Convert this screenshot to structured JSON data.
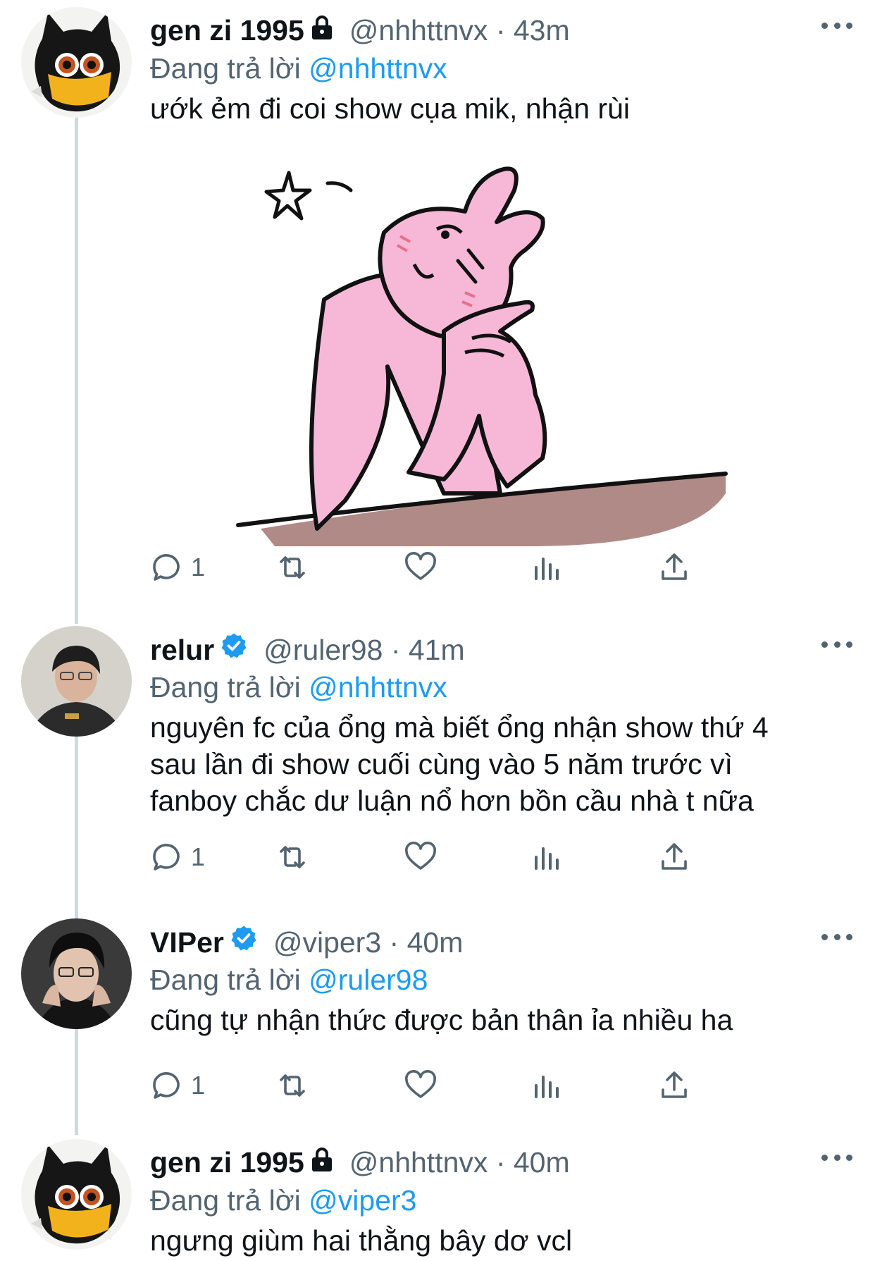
{
  "colors": {
    "accent": "#1d9bf0",
    "text_primary": "#0f1419",
    "text_secondary": "#536471",
    "thread_line": "#cfd9de",
    "sticker_pink": "#f7b8d8",
    "table_brown": "#b08a87"
  },
  "tweets": [
    {
      "display_name": "gen zi 1995",
      "badge": "lock-icon",
      "handle": "@nhhttnvx",
      "time": "43m",
      "replying_prefix": "Đang trả lời",
      "replying_to": "@nhhttnvx",
      "text": "ướk ẻm đi coi show cụa mik, nhận rùi",
      "media": "pink-bunny-sticker",
      "reply_count": "1"
    },
    {
      "display_name": "relur",
      "badge": "verified-icon",
      "handle": "@ruler98",
      "time": "41m",
      "replying_prefix": "Đang trả lời",
      "replying_to": "@nhhttnvx",
      "text_lines": [
        "nguyên fc của ổng mà biết ổng nhận show thứ 4",
        "sau lần đi show cuối cùng vào 5 năm trước vì",
        "fanboy chắc dư luận nổ hơn bồn cầu nhà t nữa"
      ],
      "reply_count": "1"
    },
    {
      "display_name": "VIPer",
      "badge": "verified-icon",
      "handle": "@viper3",
      "time": "40m",
      "replying_prefix": "Đang trả lời",
      "replying_to": "@ruler98",
      "text": "cũng tự nhận thức được bản thân ỉa nhiều ha",
      "reply_count": "1"
    },
    {
      "display_name": "gen zi 1995",
      "badge": "lock-icon",
      "handle": "@nhhttnvx",
      "time": "40m",
      "replying_prefix": "Đang trả lời",
      "replying_to": "@viper3",
      "text": "ngưng giùm hai thằng bây dơ vcl"
    }
  ],
  "separator": "·",
  "action_icons": [
    "reply-icon",
    "retweet-icon",
    "like-icon",
    "analytics-icon",
    "share-icon"
  ]
}
